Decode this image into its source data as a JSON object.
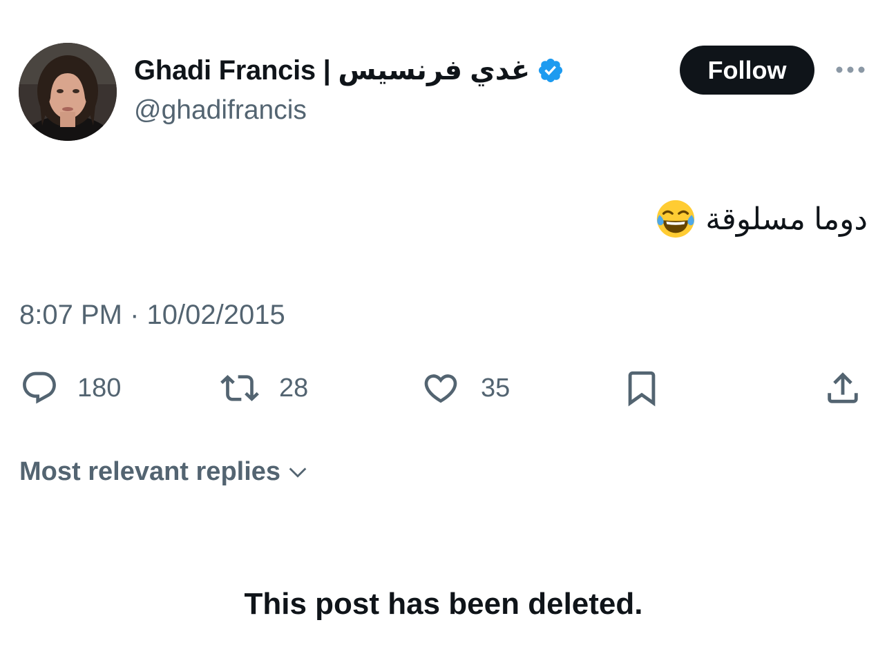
{
  "author": {
    "display_name": "Ghadi Francis | غدي فرنسيس",
    "handle": "@ghadifrancis",
    "verified": true,
    "verified_icon": "verified-badge-icon",
    "verified_color": "#1d9bf0"
  },
  "header": {
    "follow_label": "Follow",
    "more_icon": "more-dots-icon"
  },
  "post": {
    "text": "دوما مسلوقة",
    "emoji": "face-with-tears-of-joy",
    "timestamp": "8:07 PM · 10/02/2015"
  },
  "actions": {
    "replies": {
      "icon": "reply-icon",
      "count": "180"
    },
    "reposts": {
      "icon": "repost-icon",
      "count": "28"
    },
    "likes": {
      "icon": "like-icon",
      "count": "35"
    },
    "bookmark": {
      "icon": "bookmark-icon"
    },
    "share": {
      "icon": "share-icon"
    }
  },
  "replies_section": {
    "sort_label": "Most relevant replies"
  },
  "notice": {
    "deleted_text": "This post has been deleted."
  },
  "colors": {
    "text_primary": "#0f1419",
    "text_secondary": "#536471",
    "follow_bg": "#0f1419",
    "verified": "#1d9bf0"
  }
}
